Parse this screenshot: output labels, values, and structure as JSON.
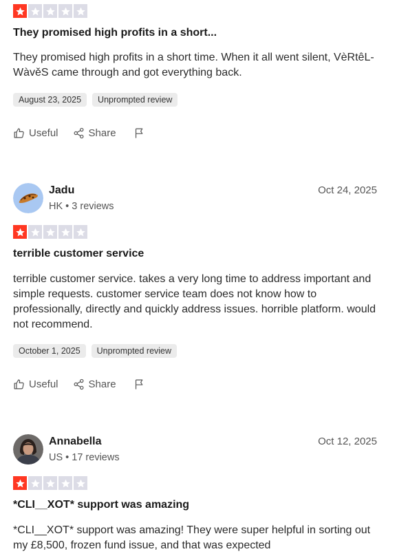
{
  "reviews": [
    {
      "rating": 1,
      "title": "They promised high profits in a short...",
      "body": [
        "They promised high profits in a short time. When it all went silent, VèRtêL-WàvěS came through and got everything back."
      ],
      "experience_date": "August 23, 2025",
      "tag": "Unprompted review"
    },
    {
      "reviewer_name": "Jadu",
      "reviewer_meta": "HK • 3 reviews",
      "date": "Oct 24, 2025",
      "rating": 1,
      "title": "terrible customer service",
      "body": [
        "terrible customer service. takes a very long time to address important and simple requests. customer service team does not know how to professionally, directly and quickly address issues. horrible platform. would not recommend."
      ],
      "experience_date": "October 1, 2025",
      "tag": "Unprompted review"
    },
    {
      "reviewer_name": "Annabella",
      "reviewer_meta": "US • 17 reviews",
      "date": "Oct 12, 2025",
      "rating": 1,
      "title": "*CLI__XOT* support was amazing",
      "body": [
        "*CLI__XOT* support was amazing! They were super helpful in sorting out my £8,500, frozen fund issue, and that was expected"
      ]
    }
  ],
  "actions": {
    "useful_label": "Useful",
    "share_label": "Share"
  },
  "colors": {
    "star_filled": "#ff3722",
    "star_empty": "#dcdce6",
    "chip_bg": "#ebebeb"
  },
  "icons": [
    "star-icon",
    "thumbs-up-icon",
    "share-icon",
    "flag-icon"
  ]
}
